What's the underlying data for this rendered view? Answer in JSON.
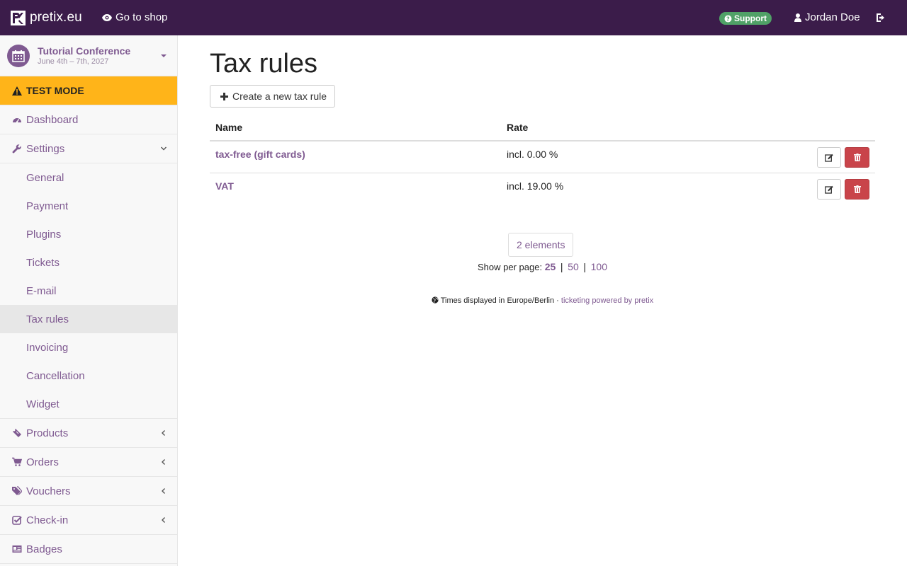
{
  "topbar": {
    "brand": "pretix.eu",
    "go_to_shop": "Go to shop",
    "support": "Support",
    "user": "Jordan Doe"
  },
  "sidebar": {
    "event": {
      "name": "Tutorial Conference",
      "dates": "June 4th – 7th, 2027"
    },
    "test_mode": "TEST MODE",
    "dashboard": "Dashboard",
    "settings": "Settings",
    "settings_items": [
      "General",
      "Payment",
      "Plugins",
      "Tickets",
      "E-mail",
      "Tax rules",
      "Invoicing",
      "Cancellation",
      "Widget"
    ],
    "products": "Products",
    "orders": "Orders",
    "vouchers": "Vouchers",
    "checkin": "Check-in",
    "badges": "Badges"
  },
  "main": {
    "title": "Tax rules",
    "create_button": "Create a new tax rule",
    "table": {
      "headers": [
        "Name",
        "Rate"
      ],
      "rows": [
        {
          "name": "tax-free (gift cards)",
          "rate": "incl. 0.00 %"
        },
        {
          "name": "VAT",
          "rate": "incl. 19.00 %"
        }
      ]
    },
    "count": "2 elements",
    "per_page_label": "Show per page:",
    "per_page_options": [
      "25",
      "50",
      "100"
    ],
    "per_page_current": "25",
    "footer_tz": "Times displayed in Europe/Berlin",
    "footer_sep": "·",
    "footer_link": "ticketing powered by pretix"
  },
  "colors": {
    "topbar": "#3b1c4a",
    "accent": "#7f5a91",
    "test_mode": "#ffb419",
    "support": "#50a167",
    "danger": "#c9444a"
  }
}
